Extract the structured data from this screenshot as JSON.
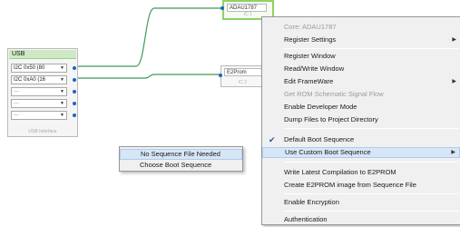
{
  "usb_block": {
    "title": "USB",
    "rows": [
      {
        "label": "I2C 0x50 (80",
        "active": true
      },
      {
        "label": "I2C 0xA0 (16",
        "active": true
      },
      {
        "label": "---",
        "active": false
      },
      {
        "label": "---",
        "active": false
      },
      {
        "label": "---",
        "active": false
      }
    ],
    "footer": "USB Interface"
  },
  "chips": {
    "adau": {
      "name": "ADAU1787",
      "id": "IC 1"
    },
    "e2prom": {
      "name": "E2Prom",
      "id": "IC 2"
    }
  },
  "colors": {
    "wire": "#3f9a5b",
    "pin": "#1f63c6",
    "usb_header": "#cfe9c4",
    "selected_chip_border": "#8fd166",
    "menu_highlight": "#d7e6f7",
    "check": "#1e55b5"
  },
  "context_menu": {
    "items": [
      {
        "label": "Core: ADAU1787",
        "disabled": true
      },
      {
        "label": "Register Settings",
        "submenu": true
      },
      {
        "label": "Register Window"
      },
      {
        "label": "Read/Write Window"
      },
      {
        "label": "Edit FrameWare",
        "submenu": true
      },
      {
        "label": "Get ROM Schematic Signal Flow",
        "disabled": true
      },
      {
        "label": "Enable Developer Mode"
      },
      {
        "label": "Dump Files to Project Directory"
      },
      {
        "label": "Default Boot Sequence",
        "checked": true
      },
      {
        "label": "Use Custom Boot Sequence",
        "submenu": true,
        "highlighted": true
      },
      {
        "label": "Write Latest Compilation to E2PROM"
      },
      {
        "label": "Create E2PROM image from Sequence File"
      },
      {
        "label": "Enable Encryption"
      },
      {
        "label": "Authentication"
      }
    ]
  },
  "submenu": {
    "items": [
      {
        "label": "No Sequence File Needed",
        "highlighted": true
      },
      {
        "label": "Choose Boot Sequence"
      }
    ]
  },
  "icons": {
    "check": "✔",
    "submenu_arrow": "▶",
    "dropdown": "▼"
  }
}
